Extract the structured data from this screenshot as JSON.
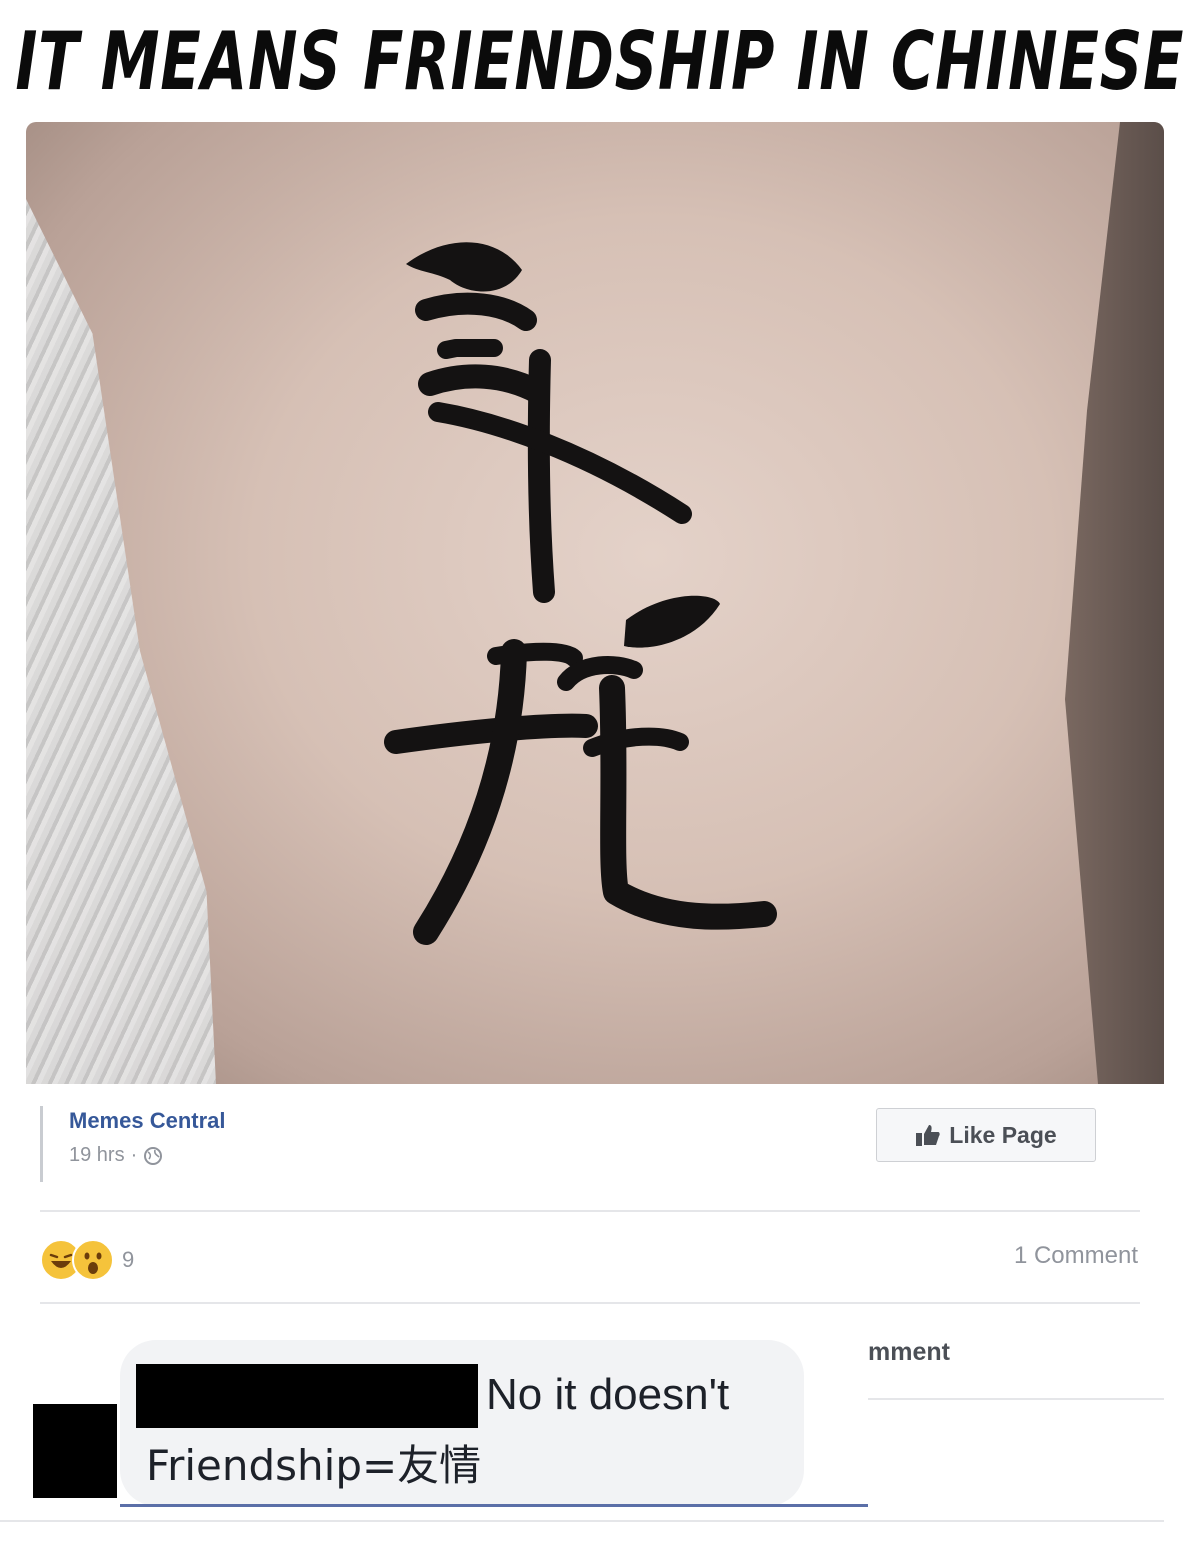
{
  "meme": {
    "caption": "IT MEANS FRIENDSHIP IN CHINESE"
  },
  "post": {
    "page_name": "Memes Central",
    "time": "19 hrs",
    "separator": "·",
    "privacy_icon": "globe-icon",
    "like_page_label": "Like Page",
    "like_icon": "thumbs-up-icon",
    "reactions": [
      "haha",
      "wow"
    ],
    "reaction_count": "9",
    "comment_count": "1 Comment",
    "comment_tab_partial": "mment"
  },
  "comment": {
    "text": "No it doesn't",
    "second_line": "Friendship=友情"
  },
  "colors": {
    "link": "#365899",
    "muted": "#90949c",
    "bubble": "#f2f3f5",
    "ink": "#0b0b0b"
  }
}
